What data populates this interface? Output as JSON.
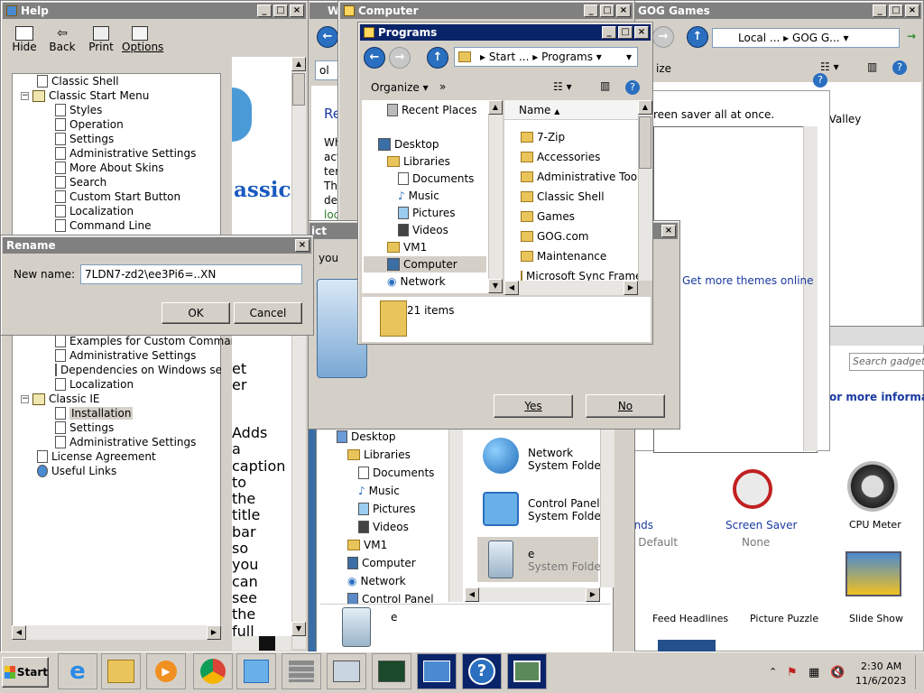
{
  "help_window": {
    "title": "Help",
    "toolbar": [
      "Hide",
      "Back",
      "Print",
      "Options"
    ],
    "tree_top": [
      "Classic Shell",
      "Classic Start Menu",
      "Styles",
      "Operation",
      "Settings",
      "Administrative Settings",
      "More About Skins",
      "Search",
      "Custom Start Button",
      "Localization",
      "Command Line"
    ],
    "tree_bottom": [
      "Examples for Custom Commands",
      "Administrative Settings",
      "Dependencies on Windows settings",
      "Localization",
      "Classic IE",
      "Installation",
      "Settings",
      "Administrative Settings",
      "License Agreement",
      "Useful Links"
    ],
    "content_logo": "assic",
    "content_words": [
      "Adds",
      "a",
      "caption",
      "to",
      "the",
      "title",
      "bar",
      "so",
      "you",
      "can",
      "see",
      "the",
      "full"
    ],
    "content_fragments": [
      "et",
      "er"
    ]
  },
  "help_content_partial": {
    "address": "ol",
    "heading": "Re",
    "lines": [
      "Wh",
      "act",
      "ter",
      "Th",
      "de",
      "loc"
    ]
  },
  "rename_dialog": {
    "title": "Rename",
    "label": "New name:",
    "value": "7LDN7-zd2\\ee3Pi6=..XN",
    "ok": "OK",
    "cancel": "Cancel"
  },
  "confirm_dialog": {
    "title_fragment": "ict",
    "text_fragment": "you",
    "yes": "Yes",
    "no": "No"
  },
  "computer_window": {
    "title": "Computer",
    "nav": [
      "Desktop",
      "Libraries",
      "Documents",
      "Music",
      "Pictures",
      "Videos",
      "VM1",
      "Computer",
      "Network",
      "Control Panel"
    ],
    "items": [
      {
        "name": "Network",
        "type": "System Folder"
      },
      {
        "name": "Control Panel",
        "type": "System Folder"
      },
      {
        "name": "e",
        "type": "System Folder"
      }
    ],
    "details_name": "e"
  },
  "programs_window": {
    "title": "Programs",
    "breadcrumb": [
      "Start ...",
      "Programs"
    ],
    "organize": "Organize",
    "more": "»",
    "nav": [
      "Recent Places",
      "Desktop",
      "Libraries",
      "Documents",
      "Music",
      "Pictures",
      "Videos",
      "VM1",
      "Computer",
      "Network"
    ],
    "column_name": "Name",
    "files": [
      "7-Zip",
      "Accessories",
      "Administrative Tools",
      "Classic Shell",
      "Games",
      "GOG.com",
      "Maintenance",
      "Microsoft Sync Framework"
    ],
    "status": "21 items"
  },
  "gog_window": {
    "title": "GOG Games",
    "breadcrumb": [
      "Local ...",
      "GOG G..."
    ],
    "organize_fragment": "ize",
    "text_fragment": "w Valley"
  },
  "personalize": {
    "screen_saver_text": "reen saver all at once.",
    "more_themes": "Get more themes online",
    "frag": "s",
    "sounds_label": "Sounds",
    "sounds_value": "ows Default",
    "saver_label": "Screen Saver",
    "saver_value": "None"
  },
  "gadgets": {
    "search_placeholder": "Search gadgets",
    "more_info": "or more information",
    "items": [
      "CPU Meter",
      "Feed Headlines",
      "Picture Puzzle",
      "Slide Show"
    ]
  },
  "taskbar": {
    "start": "Start",
    "time": "2:30 AM",
    "date": "11/6/2023"
  }
}
